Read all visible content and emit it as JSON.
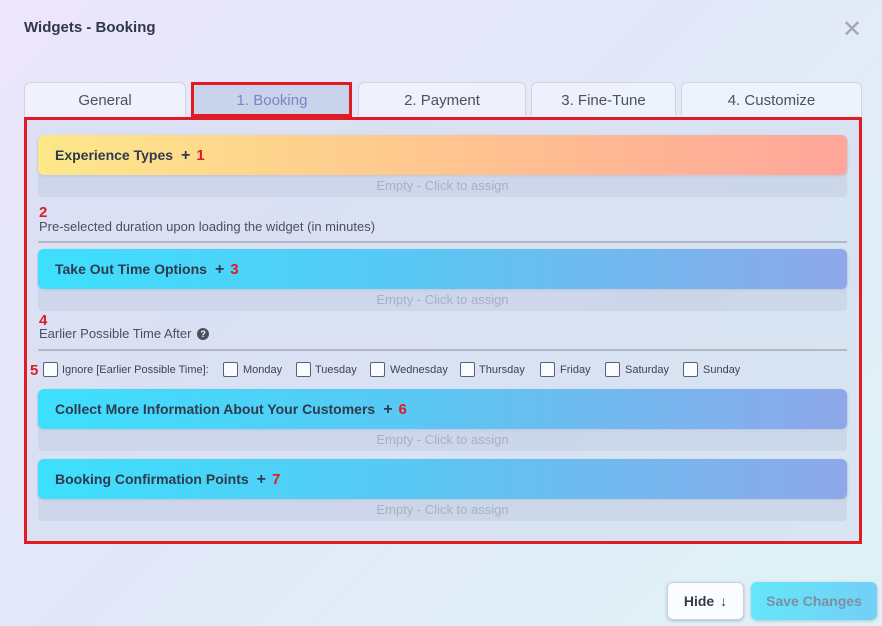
{
  "window": {
    "title": "Widgets - Booking",
    "close_glyph": "✕"
  },
  "tabs": [
    {
      "label": "General",
      "active": false
    },
    {
      "label": "1. Booking",
      "active": true
    },
    {
      "label": "2. Payment",
      "active": false
    },
    {
      "label": "3. Fine-Tune",
      "active": false
    },
    {
      "label": "4. Customize",
      "active": false
    }
  ],
  "sections": {
    "experience_types": {
      "label": "Experience Types",
      "plus": "+",
      "marker": "1",
      "empty": "Empty - Click to assign"
    },
    "duration": {
      "marker": "2",
      "label": "Pre-selected duration upon loading the widget (in minutes)"
    },
    "take_out": {
      "label": "Take Out Time Options",
      "plus": "+",
      "marker": "3",
      "empty": "Empty - Click to assign"
    },
    "earlier_time": {
      "marker": "4",
      "label": "Earlier Possible Time After",
      "help_glyph": "?"
    },
    "days": {
      "marker": "5",
      "ignore_label": "Ignore [Earlier Possible Time]:",
      "items": [
        "Monday",
        "Tuesday",
        "Wednesday",
        "Thursday",
        "Friday",
        "Saturday",
        "Sunday"
      ]
    },
    "collect_info": {
      "label": "Collect More Information About Your Customers",
      "plus": "+",
      "marker": "6",
      "empty": "Empty - Click to assign"
    },
    "confirmation": {
      "label": "Booking Confirmation Points",
      "plus": "+",
      "marker": "7",
      "empty": "Empty - Click to assign"
    }
  },
  "footer": {
    "hide_label": "Hide",
    "hide_arrow": "↓",
    "save_label": "Save Changes"
  },
  "colors": {
    "highlight": "#e01b24",
    "accent_cyan": "#3ce0fd",
    "warm_start": "#fde88a",
    "warm_end": "#ffa59a"
  }
}
